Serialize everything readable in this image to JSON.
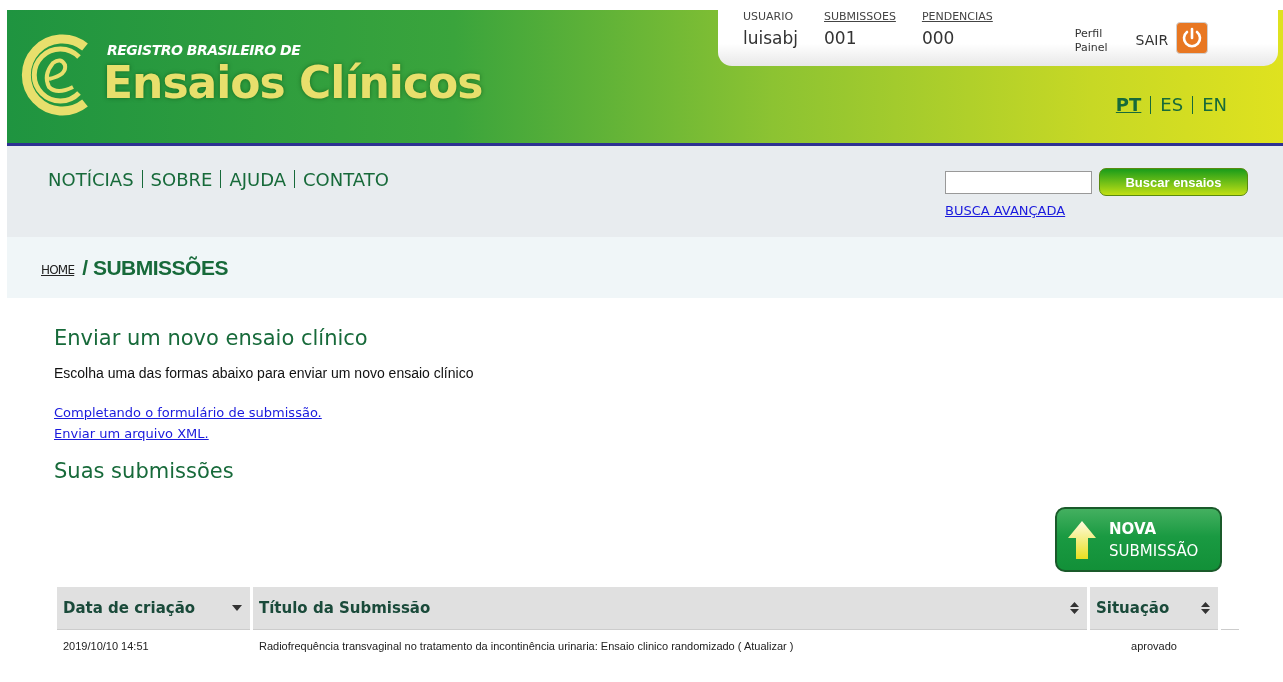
{
  "header": {
    "subtitle": "REGISTRO BRASILEIRO DE",
    "title": "Ensaios Clínicos",
    "user_panel": [
      {
        "label": "USUARIO",
        "value": "luisabj",
        "link": false
      },
      {
        "label": "SUBMISSOES",
        "value": "001",
        "link": true
      },
      {
        "label": "PENDENCIAS",
        "value": "000",
        "link": true
      }
    ],
    "profile_links": [
      "Perfil",
      "Painel"
    ],
    "logout": "SAIR",
    "languages": [
      {
        "label": "PT",
        "selected": true
      },
      {
        "label": "ES",
        "selected": false
      },
      {
        "label": "EN",
        "selected": false
      }
    ]
  },
  "nav": {
    "items": [
      "NOTÍCIAS",
      "SOBRE",
      "AJUDA",
      "CONTATO"
    ],
    "search": {
      "button": "Buscar ensaios",
      "advanced": "BUSCA AVANÇADA"
    }
  },
  "breadcrumb": {
    "home": "HOME",
    "current": "/ SUBMISSÕES"
  },
  "new_trial": {
    "heading": "Enviar um novo ensaio clínico",
    "intro": "Escolha uma das formas abaixo para enviar um novo ensaio clínico",
    "links": [
      "Completando o formulário de submissão.",
      "Enviar um arquivo XML."
    ]
  },
  "submissions": {
    "heading": "Suas submissões",
    "new_button": [
      "NOVA",
      "SUBMISSÃO"
    ],
    "table": {
      "columns": [
        {
          "label": "Data de criação",
          "sorted": true
        },
        {
          "label": "Título da Submissão",
          "sorted": false
        },
        {
          "label": "Situação",
          "sorted": false
        }
      ],
      "rows": [
        [
          "2019/10/10 14:51",
          "Radiofrequência transvaginal no tratamento da incontinência urinaria: Ensaio clinico randomizado ( Atualizar )",
          "aprovado"
        ]
      ]
    }
  }
}
